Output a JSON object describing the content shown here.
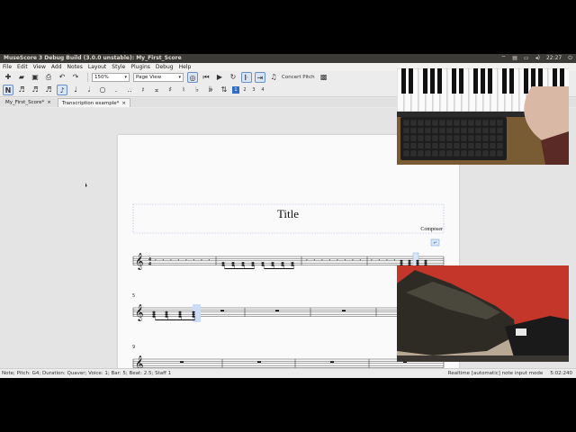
{
  "window": {
    "title": "MuseScore 3 Debug Build (3.0.0 unstable): My_First_Score",
    "tray_time": "22:27"
  },
  "menu": [
    "File",
    "Edit",
    "View",
    "Add",
    "Notes",
    "Layout",
    "Style",
    "Plugins",
    "Debug",
    "Help"
  ],
  "toolbar": {
    "zoom": "150%",
    "view_mode": "Page View",
    "concert_pitch": "Concert Pitch",
    "voices": [
      "1",
      "2",
      "3",
      "4"
    ]
  },
  "tabs": [
    {
      "label": "My_First_Score*",
      "close": "×"
    },
    {
      "label": "Transcription example*",
      "close": "×"
    }
  ],
  "score": {
    "title": "Title",
    "composer": "Composer",
    "system_numbers": [
      "5",
      "9",
      "13"
    ]
  },
  "status": {
    "left": "Note; Pitch: G4; Duration: Quaver; Voice: 1; Bar: 5; Beat: 2.5; Staff 1",
    "mode": "Realtime [automatic] note input mode",
    "position": "5:02:240"
  },
  "colors": {
    "selection": "#6d9de0",
    "panel": "#3c3b37"
  }
}
